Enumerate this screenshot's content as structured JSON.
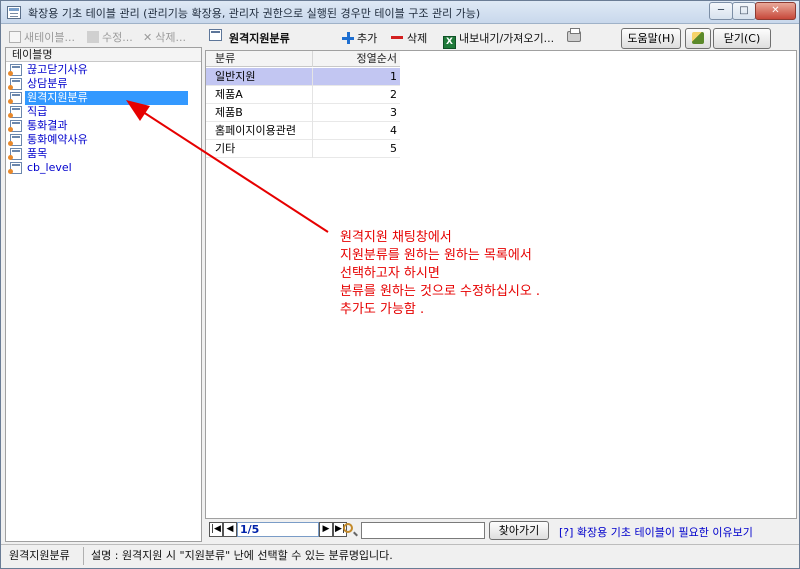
{
  "window": {
    "title": "확장용 기초 테이블 관리 (관리기능 확장용, 관리자 권한으로 실행된 경우만 테이블 구조 관리 가능)",
    "min_label": "─",
    "max_label": "□",
    "close_label": "✕"
  },
  "left_toolbar": {
    "new_label": "새테이블...",
    "edit_label": "수정...",
    "delete_label": "삭제..."
  },
  "left_panel": {
    "header": "테이블명",
    "items": [
      {
        "label": "끊고닫기사유"
      },
      {
        "label": "상담분류"
      },
      {
        "label": "원격지원분류"
      },
      {
        "label": "직급"
      },
      {
        "label": "통화결과"
      },
      {
        "label": "통화예약사유"
      },
      {
        "label": "품목"
      },
      {
        "label": "cb_level"
      }
    ],
    "selected_index": 2
  },
  "right_toolbar": {
    "title": "원격지원분류",
    "add_label": "추가",
    "delete_label": "삭제",
    "export_label": "내보내기/가져오기...",
    "excel_glyph": "X",
    "help_label": "도움말(H)",
    "close_label": "닫기(C)"
  },
  "grid": {
    "columns": [
      "분류",
      "정열순서"
    ],
    "rows": [
      {
        "name": "일반지원",
        "order": "1"
      },
      {
        "name": "제품A",
        "order": "2"
      },
      {
        "name": "제품B",
        "order": "3"
      },
      {
        "name": "홈페이지이용관련",
        "order": "4"
      },
      {
        "name": "기타",
        "order": "5"
      }
    ],
    "selected_index": 0
  },
  "nav": {
    "first": "|◀",
    "prev": "◀",
    "next": "▶",
    "last": "▶|",
    "page": "1/5",
    "find_label": "찾아가기",
    "reason_link": "[?] 확장용 기초 테이블이 필요한 이유보기"
  },
  "status": {
    "table": "원격지원분류",
    "description": "설명 : 원격지원 시 \"지원분류\" 난에 선택할 수 있는 분류명입니다."
  },
  "annotation": {
    "lines": [
      "원격지원 채팅창에서",
      "지원분류를 원하는 원하는 목록에서",
      "선택하고자 하시면",
      "분류를 원하는 것으로 수정하십시오 .",
      "추가도 가능함 ."
    ],
    "color": "#e60000"
  }
}
